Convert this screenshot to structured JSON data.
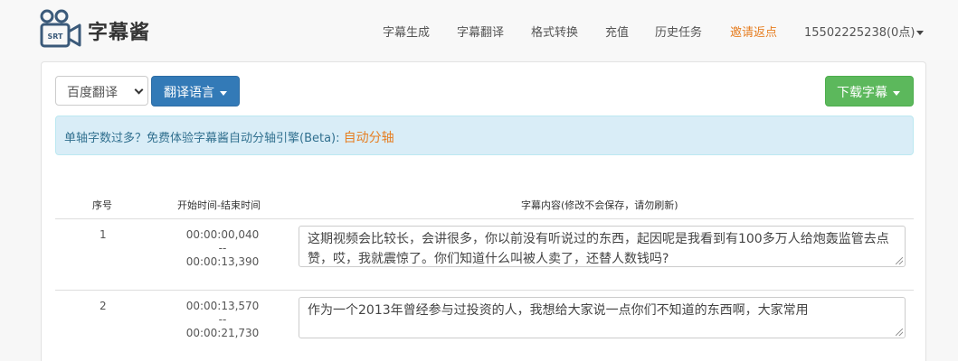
{
  "brand": {
    "name": "字幕酱",
    "logo_text": "SRT",
    "logo_icon": "camera-icon"
  },
  "nav": {
    "items": [
      "字幕生成",
      "字幕翻译",
      "格式转换",
      "充值",
      "历史任务",
      "邀请返点"
    ],
    "active_color": "#e67e22",
    "user": "15502225238(0点)"
  },
  "toolbar": {
    "engine_select": "百度翻译",
    "translate_button": "翻译语言",
    "download_button": "下载字幕"
  },
  "alert": {
    "text": "单轴字数过多？免费体验字幕酱自动分轴引擎(Beta): ",
    "link": "自动分轴"
  },
  "table": {
    "headers": [
      "序号",
      "开始时间-结束时间",
      "字幕内容(修改不会保存，请勿刷新)"
    ],
    "rows": [
      {
        "index": "1",
        "start": "00:00:00,040",
        "sep": "--",
        "end": "00:00:13,390",
        "content": "这期视频会比较长，会讲很多，你以前没有听说过的东西，起因呢是我看到有100多万人给炮轰监管去点赞，哎，我就震惊了。你们知道什么叫被人卖了，还替人数钱吗?"
      },
      {
        "index": "2",
        "start": "00:00:13,570",
        "sep": "--",
        "end": "00:00:21,730",
        "content": "作为一个2013年曾经参与过投资的人，我想给大家说一点你们不知道的东西啊，大家常用"
      }
    ]
  },
  "colors": {
    "primary": "#337ab7",
    "success": "#5cb85c",
    "info_bg": "#d9edf7",
    "info_text": "#31708f"
  }
}
